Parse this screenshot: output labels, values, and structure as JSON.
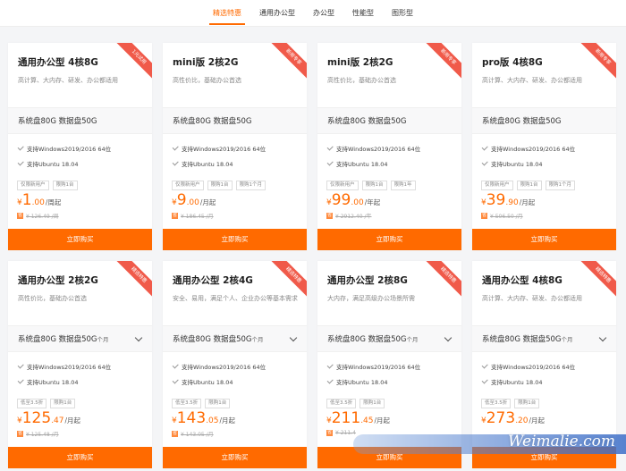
{
  "tabs": [
    {
      "label": "精选特惠",
      "active": true
    },
    {
      "label": "通用办公型",
      "active": false
    },
    {
      "label": "办公型",
      "active": false
    },
    {
      "label": "性能型",
      "active": false
    },
    {
      "label": "图形型",
      "active": false
    }
  ],
  "features": [
    "支持Windows2019/2016 64位",
    "支持Ubuntu 18.04"
  ],
  "buy_label": "立即购买",
  "colors": {
    "accent": "#ff6a00",
    "ribbon": "#f05a4a"
  },
  "cards": [
    {
      "ribbon": "1元试用",
      "title": "通用办公型 4核8G",
      "desc": "高计算、大内存、研发、办公都适用",
      "spec": "系统盘80G 数据盘50G",
      "spec_unit": "",
      "badges": [
        "仅限新用户",
        "限购1台"
      ],
      "cur": "¥",
      "int": "1",
      "dec": ".00",
      "per": "/周起",
      "orig": "¥ 126.49 /周"
    },
    {
      "ribbon": "新用专享",
      "title": "mini版 2核2G",
      "desc": "高性价比，基础办公首选",
      "spec": "系统盘80G 数据盘50G",
      "spec_unit": "",
      "badges": [
        "仅限新用户",
        "限购1台",
        "限购1个月"
      ],
      "cur": "¥",
      "int": "9",
      "dec": ".00",
      "per": "/月起",
      "orig": "¥ 186.45 /月"
    },
    {
      "ribbon": "新用专享",
      "title": "mini版 2核2G",
      "desc": "高性价比，基础办公首选",
      "spec": "系统盘80G 数据盘50G",
      "spec_unit": "",
      "badges": [
        "仅限新用户",
        "限购1台",
        "限购1年"
      ],
      "cur": "¥",
      "int": "99",
      "dec": ".00",
      "per": "/年起",
      "orig": "¥ 2912.40 /年"
    },
    {
      "ribbon": "新用专享",
      "title": "pro版 4核8G",
      "desc": "高计算、大内存、研发、办公都适用",
      "spec": "系统盘80G 数据盘50G",
      "spec_unit": "",
      "badges": [
        "仅限新用户",
        "限购1台",
        "限购1个月"
      ],
      "cur": "¥",
      "int": "39",
      "dec": ".90",
      "per": "/月起",
      "orig": "¥ 506.50 /月"
    },
    {
      "ribbon": "精选特惠",
      "title": "通用办公型 2核2G",
      "desc": "高性价比，基础办公首选",
      "spec": "系统盘80G 数据盘50G",
      "spec_unit": "个月",
      "badges": [
        "低至3.5折",
        "限购1台"
      ],
      "cur": "¥",
      "int": "125",
      "dec": ".47",
      "per": "/月起",
      "orig": "¥ 125.48 /月"
    },
    {
      "ribbon": "精选特惠",
      "title": "通用办公型 2核4G",
      "desc": "安全、易用，满足个人、企业办公等基本需求",
      "spec": "系统盘80G 数据盘50G",
      "spec_unit": "个月",
      "badges": [
        "低至3.5折",
        "限购1台"
      ],
      "cur": "¥",
      "int": "143",
      "dec": ".05",
      "per": "/月起",
      "orig": "¥ 143.05 /月"
    },
    {
      "ribbon": "精选特惠",
      "title": "通用办公型 2核8G",
      "desc": "大内存，满足高级办公场景所需",
      "spec": "系统盘80G 数据盘50G",
      "spec_unit": "个月",
      "badges": [
        "低至3.5折",
        "限购1台"
      ],
      "cur": "¥",
      "int": "211",
      "dec": ".45",
      "per": "/月起",
      "orig": "¥ 211.4"
    },
    {
      "ribbon": "精选特惠",
      "title": "通用办公型 4核8G",
      "desc": "高计算、大内存、研发、办公都适用",
      "spec": "系统盘80G 数据盘50G",
      "spec_unit": "个月",
      "badges": [
        "低至3.5折",
        "限购1台"
      ],
      "cur": "¥",
      "int": "273",
      "dec": ".20",
      "per": "/月起",
      "orig": ""
    }
  ],
  "watermark": "Weimalie.com"
}
